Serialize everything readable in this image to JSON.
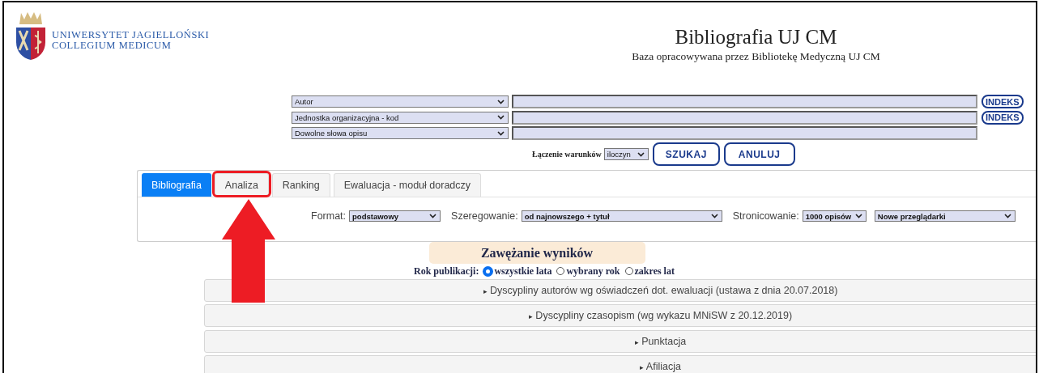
{
  "header": {
    "logo_lines": [
      "UNIWERSYTET JAGIELLOŃSKI",
      "COLLEGIUM MEDICUM"
    ],
    "title": "Bibliografia UJ CM",
    "subtitle": "Baza opracowywana przez Bibliotekę Medyczną UJ CM"
  },
  "search_rows": [
    {
      "field": "Autor",
      "index_button": "INDEKS"
    },
    {
      "field": "Jednostka organizacyjna - kod",
      "index_button": "INDEKS"
    },
    {
      "field": "Dowolne słowa opisu"
    }
  ],
  "combine": {
    "label": "Łączenie warunków",
    "value": "iloczyn",
    "buttons": [
      "SZUKAJ",
      "ANULUJ"
    ]
  },
  "tabs": [
    {
      "label": "Bibliografia",
      "selected": true,
      "highlighted": false
    },
    {
      "label": "Analiza",
      "selected": false,
      "highlighted": true
    },
    {
      "label": "Ranking",
      "selected": false,
      "highlighted": false
    },
    {
      "label": "Ewaluacja - moduł doradczy",
      "selected": false,
      "highlighted": false
    }
  ],
  "options": [
    {
      "label": "Format:",
      "value": "podstawowy"
    },
    {
      "label": "Szeregowanie:",
      "value": "od najnowszego + tytuł"
    },
    {
      "label": "Stronicowanie:",
      "value": "1000 opisów"
    },
    {
      "value": "Nowe przeglądarki"
    }
  ],
  "narrowing": {
    "title": "Zawężanie wyników",
    "year_label": "Rok publikacji:",
    "year_options": [
      {
        "label": "wszystkie lata",
        "selected": true
      },
      {
        "label": "wybrany rok",
        "selected": false
      },
      {
        "label": "zakres lat",
        "selected": false
      }
    ]
  },
  "sections": [
    {
      "arrow": "▸",
      "label": "Dyscypliny autorów wg oświadczeń dot. ewaluacji (ustawa z dnia 20.07.2018)"
    },
    {
      "arrow": "▸",
      "label": "Dyscypliny czasopism (wg wykazu MNiSW z 20.12.2019)"
    },
    {
      "arrow": "▸",
      "label": "Punktacja"
    },
    {
      "arrow": "▸",
      "label": "Afiliacja"
    }
  ]
}
